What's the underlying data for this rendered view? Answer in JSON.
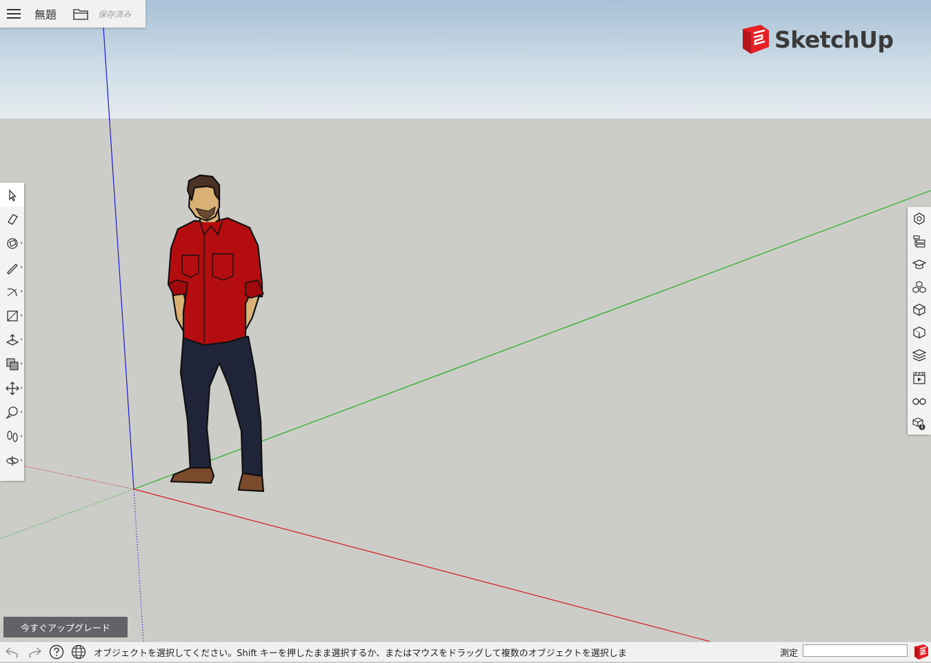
{
  "header": {
    "title": "無題",
    "saved_label": "保存済み"
  },
  "brand": {
    "name": "SketchUp",
    "color": "#e52128"
  },
  "left_toolbar": {
    "tools": [
      {
        "icon": "select-arrow-icon",
        "active": true
      },
      {
        "icon": "eraser-icon"
      },
      {
        "icon": "paint-bucket-icon"
      },
      {
        "icon": "pencil-line-icon"
      },
      {
        "icon": "arc-icon"
      },
      {
        "icon": "rectangle-icon"
      },
      {
        "icon": "push-pull-icon"
      },
      {
        "icon": "offset-icon"
      },
      {
        "icon": "move-icon"
      },
      {
        "icon": "tape-measure-icon"
      },
      {
        "icon": "walk-footprints-icon"
      },
      {
        "icon": "orbit-icon"
      }
    ]
  },
  "right_toolbar": {
    "panels": [
      "entity-info-icon",
      "outliner-icon",
      "instructor-icon",
      "components-icon",
      "materials-icon",
      "solid-inspector-icon",
      "layers-icon",
      "scenes-icon",
      "display-style-icon",
      "model-info-icon"
    ]
  },
  "upgrade_button": {
    "label": "今すぐアップグレード"
  },
  "statusbar": {
    "message": "オブジェクトを選択してください。Shift キーを押したまま選択するか、またはマウスをドラッグして複数のオブジェクトを選択しま",
    "measure_label": "測定",
    "measure_value": ""
  },
  "axes_colors": {
    "red": "#d51a1a",
    "green": "#1fae1f",
    "blue": "#1a1ad0"
  },
  "scene": {
    "sky_color": "#a8c1d6",
    "ground_color": "#cccdc8"
  }
}
